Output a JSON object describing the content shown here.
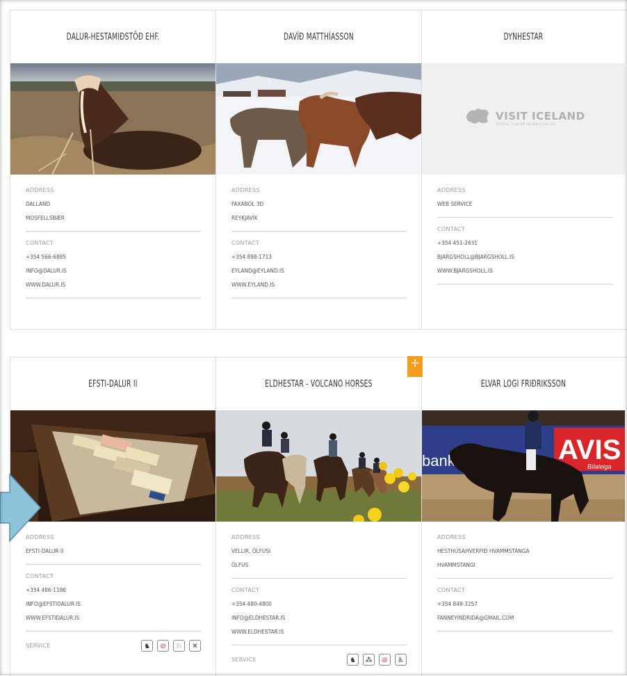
{
  "cards": [
    {
      "title": "DALUR-HESTAMIÐSTÖÐ EHF.",
      "address_label": "ADDRESS",
      "address": [
        "DALLAND",
        "MOSFELLSBÆR"
      ],
      "contact_label": "CONTACT",
      "contact": [
        "+354 566-6885",
        "INFO@DALUR.IS",
        "WWW.DALUR.IS"
      ]
    },
    {
      "title": "DAVÍÐ MATTHÍASSON",
      "address_label": "ADDRESS",
      "address": [
        "FAXABÓL 3D",
        "REYKJAVÍK"
      ],
      "contact_label": "CONTACT",
      "contact": [
        "+354 898-1713",
        "EYLAND@EYLAND.IS",
        "WWW.EYLAND.IS"
      ]
    },
    {
      "title": "DYNHESTAR",
      "logo_text": "VISIT ICELAND",
      "logo_subtext": "OFFICIAL TOURISM INFORMATION SITE",
      "address_label": "ADDRESS",
      "address": [
        "WEB SERVICE"
      ],
      "contact_label": "CONTACT",
      "contact": [
        "+354 451-2631",
        "BJARGSHOLL@BJARGSHOLL.IS",
        "WWW.BJARGSHOLL.IS"
      ]
    },
    {
      "title": "EFSTI-DALUR II",
      "address_label": "ADDRESS",
      "address": [
        "EFSTI-DALUR II"
      ],
      "contact_label": "CONTACT",
      "contact": [
        "+354 486-1186",
        "INFO@EFSTIDALUR.IS",
        "WWW.EFSTIDALUR.IS"
      ],
      "service_label": "SERVICE",
      "services": [
        {
          "icon": "horse-riding-icon",
          "glyph": "♞",
          "color": "#333333"
        },
        {
          "icon": "no-smoking-icon",
          "glyph": "⊘",
          "color": "#e02a3b"
        },
        {
          "icon": "horse-rental-icon",
          "glyph": "♘",
          "color": "#333333"
        },
        {
          "icon": "restaurant-icon",
          "glyph": "✕",
          "color": "#333333"
        }
      ]
    },
    {
      "title": "ELDHESTAR - VOLCANO HORSES",
      "address_label": "ADDRESS",
      "address": [
        "VELLIR, ÖLFUSI",
        "ÖLFUS"
      ],
      "contact_label": "CONTACT",
      "contact": [
        "+354 480-4800",
        "INFO@ELDHESTAR.IS",
        "WWW.ELDHESTAR.IS"
      ],
      "service_label": "SERVICE",
      "services": [
        {
          "icon": "horse-riding-icon",
          "glyph": "♞",
          "color": "#333333"
        },
        {
          "icon": "group-icon",
          "glyph": "⁂",
          "color": "#333333"
        },
        {
          "icon": "no-smoking-icon",
          "glyph": "⊘",
          "color": "#e02a3b"
        },
        {
          "icon": "wheelchair-icon",
          "glyph": "♿",
          "color": "#333333"
        }
      ]
    },
    {
      "title": "ELVAR LOGI FRIÐRIKSSON",
      "photo_banner_left": "bank",
      "photo_banner_right": "AVIS",
      "photo_banner_sub": "Bílaleiga",
      "address_label": "ADDRESS",
      "address": [
        "HESTHÚSAHVERFIÐ HVAMMSTANGA",
        "HVAMMSTANGI"
      ],
      "contact_label": "CONTACT",
      "contact": [
        "+354 848-3257",
        "FANNEYINDRIDA@GMAIL.COM"
      ]
    }
  ],
  "colors": {
    "badge": "#f39c1e",
    "arrow": "#8ec3dc",
    "accent_red": "#e02a3b"
  }
}
